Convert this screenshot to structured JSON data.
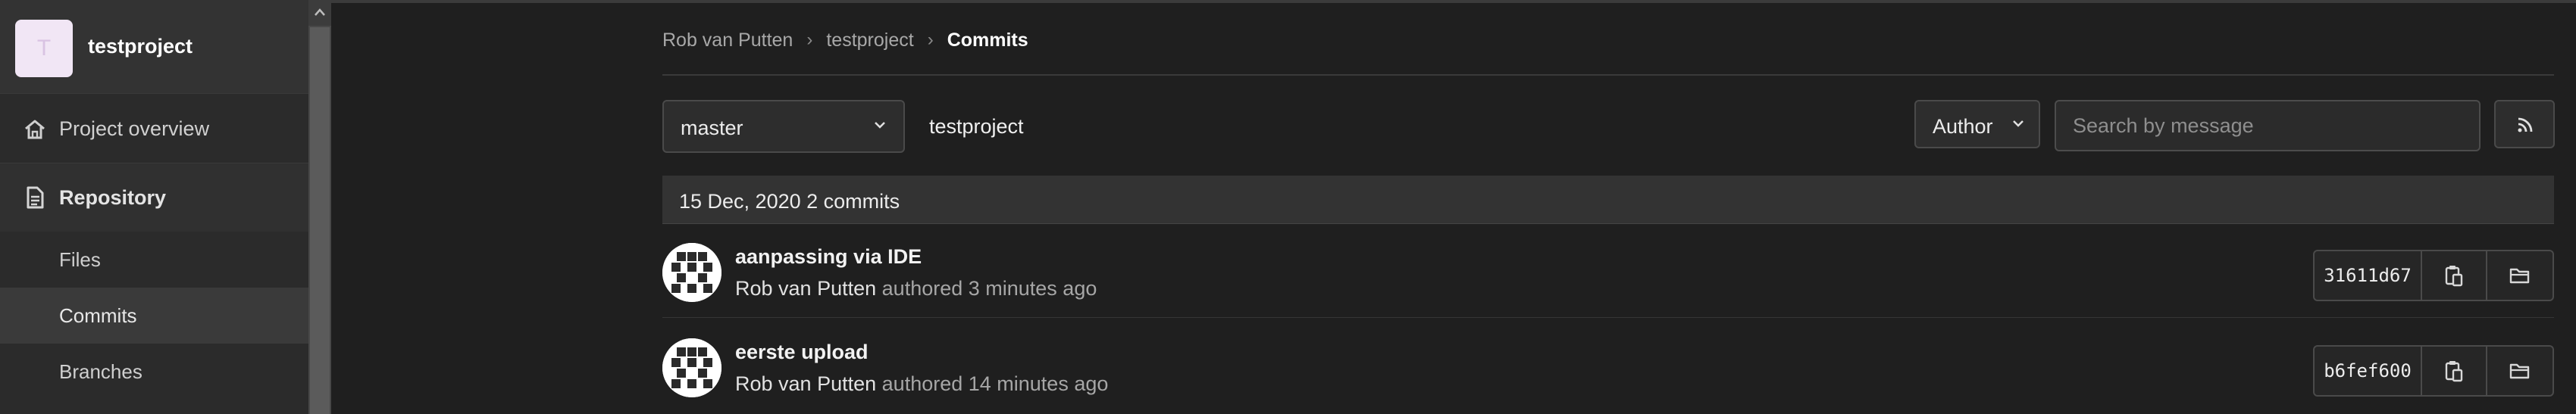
{
  "sidebar": {
    "project_avatar_letter": "T",
    "project_name": "testproject",
    "overview_label": "Project overview",
    "repository_label": "Repository",
    "sub_items": [
      "Files",
      "Commits",
      "Branches"
    ]
  },
  "breadcrumb": {
    "items": [
      "Rob van Putten",
      "testproject"
    ],
    "separator": "›",
    "current": "Commits"
  },
  "filters": {
    "branch": "master",
    "project_path": "testproject",
    "author_label": "Author",
    "search_placeholder": "Search by message"
  },
  "commits_group": {
    "header": "15 Dec, 2020 2 commits",
    "commits": [
      {
        "title": "aanpassing via IDE",
        "author": "Rob van Putten",
        "meta": "authored 3 minutes ago",
        "sha": "31611d67"
      },
      {
        "title": "eerste upload",
        "author": "Rob van Putten",
        "meta": "authored 14 minutes ago",
        "sha": "b6fef600"
      }
    ]
  },
  "colors": {
    "background": "#1f1f1f",
    "sidebar": "#2b2b2b",
    "active_item": "#3a3a3a",
    "border": "#4a4a4a"
  }
}
